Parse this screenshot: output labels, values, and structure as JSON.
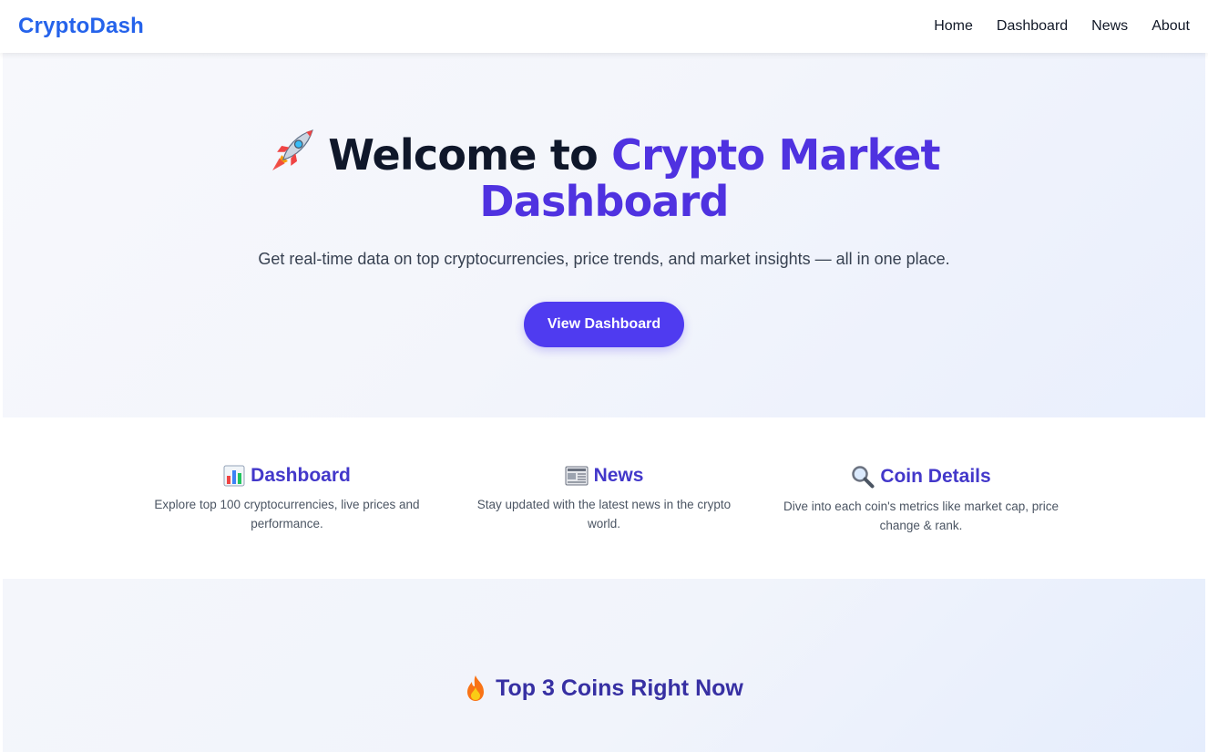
{
  "navbar": {
    "brand": "CryptoDash",
    "links": [
      "Home",
      "Dashboard",
      "News",
      "About"
    ]
  },
  "hero": {
    "title_prefix": "Welcome to",
    "title_accent": "Crypto Market Dashboard",
    "subtitle": "Get real-time data on top cryptocurrencies, price trends, and market insights — all in one place.",
    "cta_label": "View Dashboard",
    "icon": "rocket-icon"
  },
  "features": [
    {
      "icon": "bar-chart-icon",
      "title": "Dashboard",
      "description": "Explore top 100 cryptocurrencies, live prices and performance."
    },
    {
      "icon": "newspaper-icon",
      "title": "News",
      "description": "Stay updated with the latest news in the crypto world."
    },
    {
      "icon": "magnifier-icon",
      "title": "Coin Details",
      "description": "Dive into each coin's metrics like market cap, price change & rank."
    }
  ],
  "top_coins": {
    "title": "Top 3 Coins Right Now",
    "icon": "fire-icon"
  },
  "colors": {
    "brand": "#2563eb",
    "accent": "#4f32e0",
    "button": "#4f3bf0",
    "feature_title": "#4338ca"
  }
}
